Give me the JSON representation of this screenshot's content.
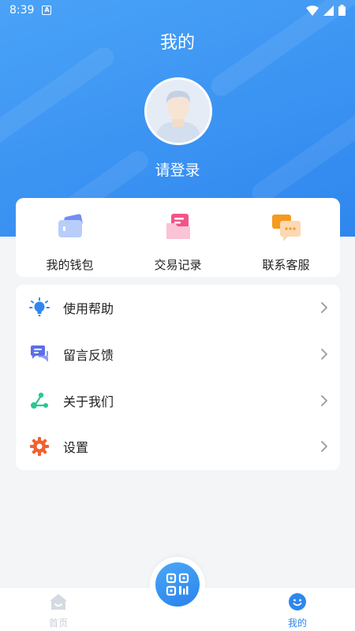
{
  "status_bar": {
    "time": "8:39",
    "notification_icon": "a-box-icon",
    "wifi_icon": "wifi-icon",
    "battery_icon": "battery-icon"
  },
  "header": {
    "title": "我的",
    "avatar_icon": "user-avatar-icon",
    "login_label": "请登录"
  },
  "quick_actions": [
    {
      "label": "我的钱包",
      "icon": "wallet-icon"
    },
    {
      "label": "交易记录",
      "icon": "transaction-record-icon"
    },
    {
      "label": "联系客服",
      "icon": "customer-service-icon"
    }
  ],
  "menu": [
    {
      "label": "使用帮助",
      "icon": "lightbulb-icon"
    },
    {
      "label": "留言反馈",
      "icon": "chat-feedback-icon"
    },
    {
      "label": "关于我们",
      "icon": "share-nodes-icon"
    },
    {
      "label": "设置",
      "icon": "gear-icon"
    }
  ],
  "tabbar": {
    "home_label": "首页",
    "mine_label": "我的",
    "scan_icon": "qr-scan-icon"
  },
  "colors": {
    "primary": "#2f86ee",
    "background": "#f4f5f7",
    "inactive_tab": "#c9ced6"
  }
}
